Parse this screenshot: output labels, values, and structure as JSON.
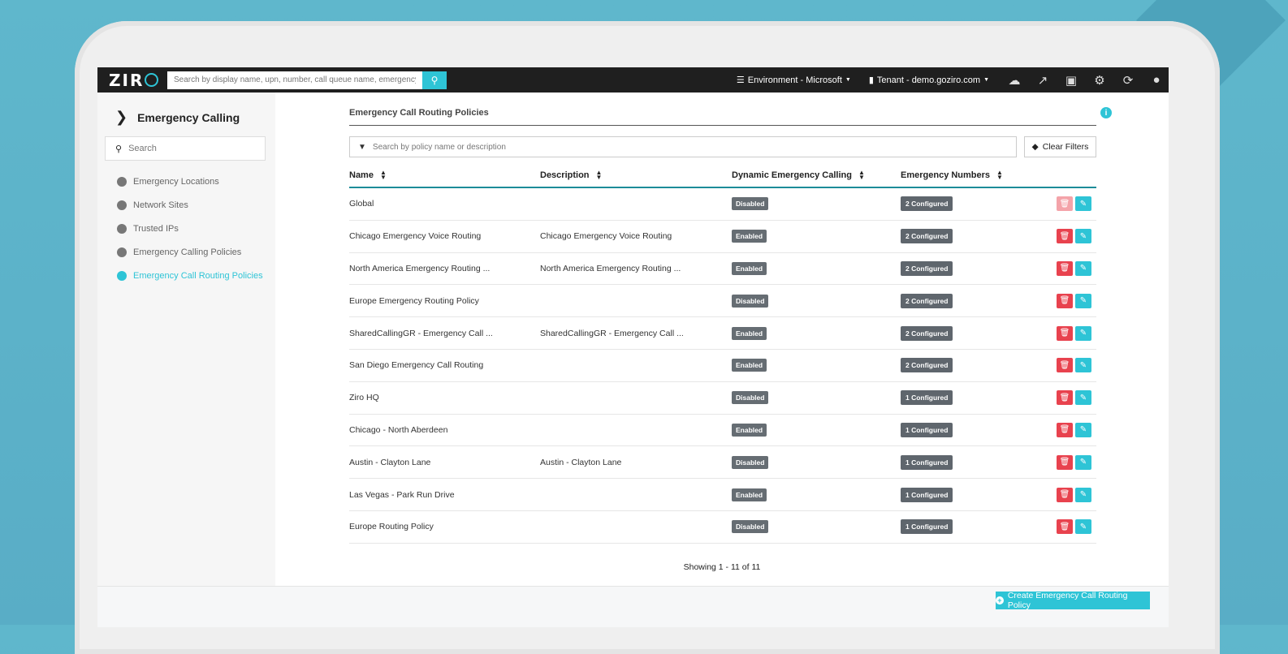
{
  "topbar": {
    "logo": "ZIR",
    "search_placeholder": "Search by display name, upn, number, call queue name, emergency locat",
    "environment": "Environment - Microsoft",
    "tenant": "Tenant - demo.goziro.com",
    "icons": [
      "cloud-sync-icon",
      "chart-icon",
      "robot-icon",
      "gear-icon",
      "sync-icon",
      "user-icon"
    ]
  },
  "sidebar": {
    "title": "Emergency Calling",
    "search_placeholder": "Search",
    "items": [
      {
        "label": "Emergency Locations",
        "icon": "globe-pin-icon",
        "active": false
      },
      {
        "label": "Network Sites",
        "icon": "globe-icon",
        "active": false
      },
      {
        "label": "Trusted IPs",
        "icon": "shield-icon",
        "active": false
      },
      {
        "label": "Emergency Calling Policies",
        "icon": "phone-icon",
        "active": false
      },
      {
        "label": "Emergency Call Routing Policies",
        "icon": "phone-route-icon",
        "active": true
      }
    ]
  },
  "main": {
    "title": "Emergency Call Routing Policies",
    "filter_placeholder": "Search by policy name or description",
    "clear_filters": "Clear Filters",
    "columns": [
      "Name",
      "Description",
      "Dynamic Emergency Calling",
      "Emergency Numbers"
    ],
    "rows": [
      {
        "name": "Global",
        "description": "",
        "dynamic": "Disabled",
        "numbers": "2 Configured",
        "delete_disabled": true
      },
      {
        "name": "Chicago Emergency Voice Routing",
        "description": "Chicago Emergency Voice Routing",
        "dynamic": "Enabled",
        "numbers": "2 Configured",
        "delete_disabled": false
      },
      {
        "name": "North America Emergency Routing ...",
        "description": "North America Emergency Routing ...",
        "dynamic": "Enabled",
        "numbers": "2 Configured",
        "delete_disabled": false
      },
      {
        "name": "Europe Emergency Routing Policy",
        "description": "",
        "dynamic": "Disabled",
        "numbers": "2 Configured",
        "delete_disabled": false
      },
      {
        "name": "SharedCallingGR - Emergency Call ...",
        "description": "SharedCallingGR - Emergency Call ...",
        "dynamic": "Enabled",
        "numbers": "2 Configured",
        "delete_disabled": false
      },
      {
        "name": "San Diego Emergency Call Routing",
        "description": "",
        "dynamic": "Enabled",
        "numbers": "2 Configured",
        "delete_disabled": false
      },
      {
        "name": "Ziro HQ",
        "description": "",
        "dynamic": "Disabled",
        "numbers": "1 Configured",
        "delete_disabled": false
      },
      {
        "name": "Chicago - North Aberdeen",
        "description": "",
        "dynamic": "Enabled",
        "numbers": "1 Configured",
        "delete_disabled": false
      },
      {
        "name": "Austin - Clayton Lane",
        "description": "Austin - Clayton Lane",
        "dynamic": "Disabled",
        "numbers": "1 Configured",
        "delete_disabled": false
      },
      {
        "name": "Las Vegas - Park Run Drive",
        "description": "",
        "dynamic": "Enabled",
        "numbers": "1 Configured",
        "delete_disabled": false
      },
      {
        "name": "Europe Routing Policy",
        "description": "",
        "dynamic": "Disabled",
        "numbers": "1 Configured",
        "delete_disabled": false
      }
    ],
    "showing": "Showing 1 - 11 of 11"
  },
  "footer": {
    "create_button": "Create Emergency Call Routing Policy"
  },
  "colors": {
    "accent": "#2ec4d6",
    "danger": "#e8424e",
    "topbar": "#1f1f1f",
    "badge": "#666d73"
  }
}
